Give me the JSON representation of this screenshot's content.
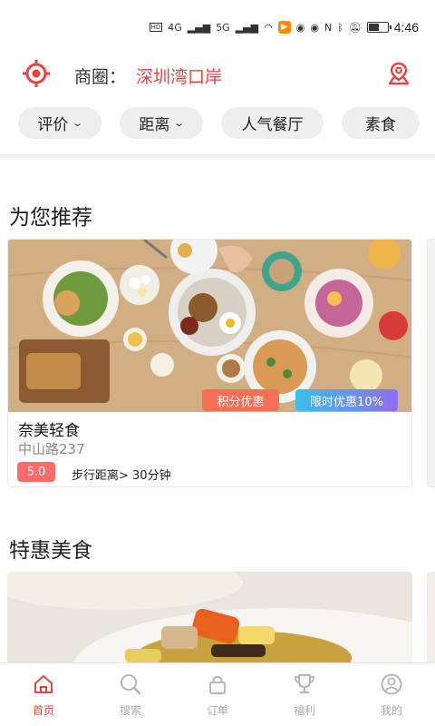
{
  "status_bar": {
    "time": "4:46",
    "signal_1": "4G",
    "signal_2": "5G",
    "battery_level": 0.6
  },
  "header": {
    "area_label": "商圈：",
    "area_value": "深圳湾口岸"
  },
  "filters": [
    {
      "label": "评价",
      "dropdown": true
    },
    {
      "label": "距离",
      "dropdown": true
    },
    {
      "label": "人气餐厅",
      "dropdown": false
    },
    {
      "label": "素食",
      "dropdown": false
    }
  ],
  "sections": {
    "recommend_title": "为您推荐",
    "deals_title": "特惠美食"
  },
  "recommend_card": {
    "name": "奈美轻食",
    "address": "中山路237",
    "rating": "5.0",
    "walk": "步行距离> 30分钟",
    "badges": [
      "积分优惠",
      "限时优惠10%"
    ]
  },
  "tabs": [
    {
      "label": "首页",
      "icon": "home-icon",
      "active": true
    },
    {
      "label": "搜索",
      "icon": "search-icon",
      "active": false
    },
    {
      "label": "订单",
      "icon": "lock-bag-icon",
      "active": false
    },
    {
      "label": "福利",
      "icon": "trophy-icon",
      "active": false
    },
    {
      "label": "我的",
      "icon": "user-icon",
      "active": false
    }
  ],
  "colors": {
    "accent": "#e8433f",
    "chip_bg": "#eeeeee",
    "points_badge": "#f46f56",
    "rating_badge": "#ff6b6b"
  }
}
